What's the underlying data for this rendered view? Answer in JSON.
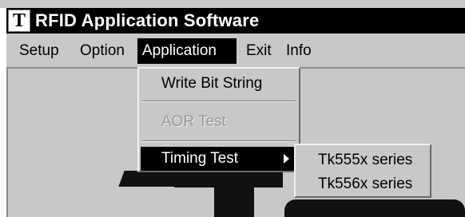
{
  "window": {
    "title": "RFID Application Software",
    "logo_letter": "T"
  },
  "menubar": {
    "items": [
      {
        "label": "Setup"
      },
      {
        "label": "Option"
      },
      {
        "label": "Application",
        "active": true
      },
      {
        "label": "Exit"
      },
      {
        "label": "Info"
      }
    ]
  },
  "application_menu": {
    "items": [
      {
        "label": "Write Bit String",
        "enabled": true
      },
      {
        "label": "AOR Test",
        "enabled": false
      },
      {
        "label": "Timing Test",
        "enabled": true,
        "highlighted": true,
        "has_submenu": true
      }
    ]
  },
  "timing_test_submenu": {
    "items": [
      {
        "label": "Tk555x series"
      },
      {
        "label": "Tk556x series"
      }
    ]
  },
  "colors": {
    "titlebar": "#000000",
    "menu_face": "#c8c8c8",
    "highlight": "#000000",
    "disabled_text": "#9a9a9a"
  }
}
